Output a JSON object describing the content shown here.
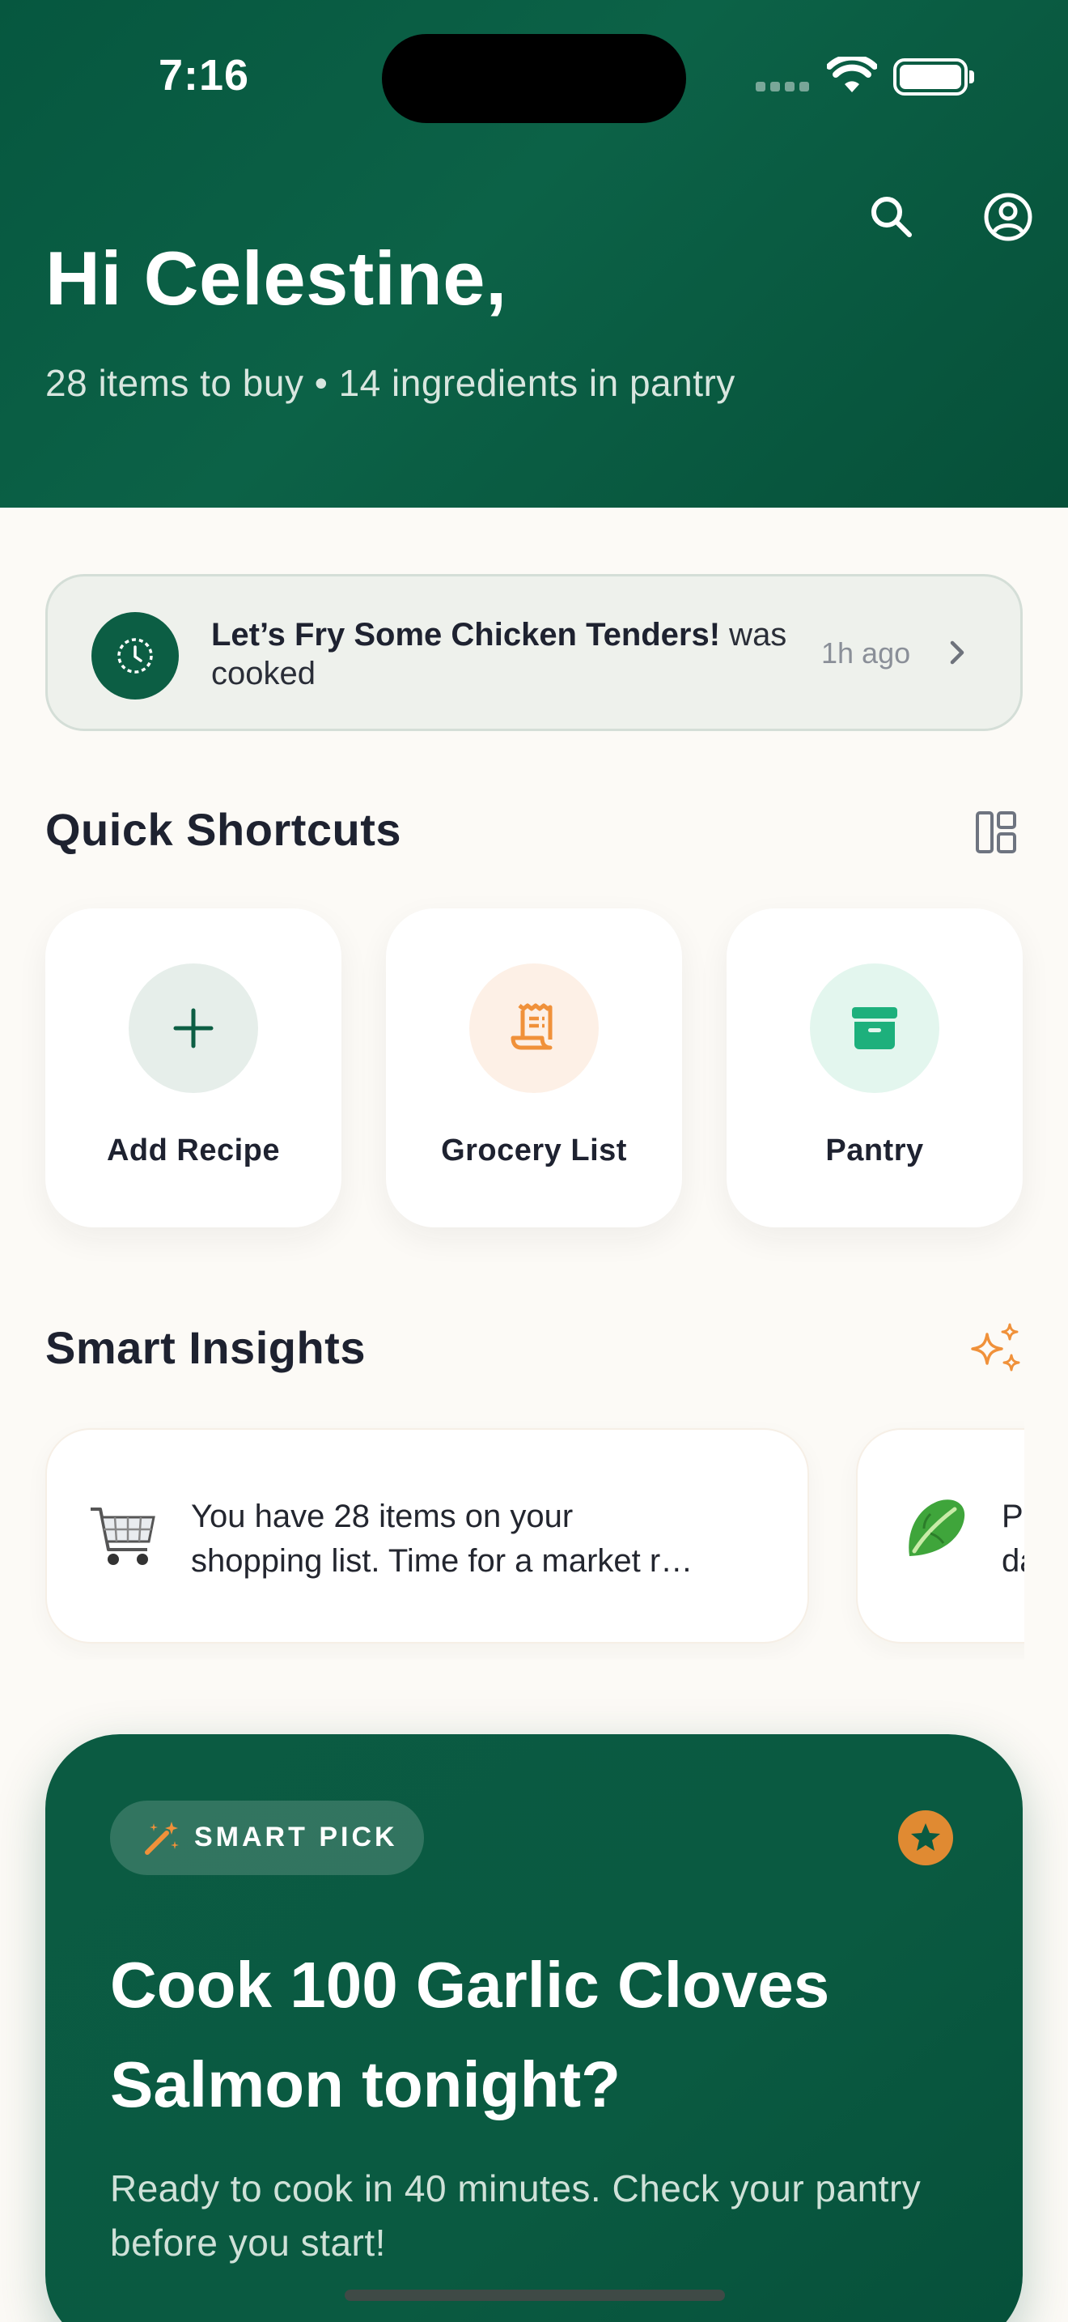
{
  "status_bar": {
    "time": "7:16"
  },
  "header": {
    "greeting": "Hi Celestine,",
    "summary": "28 items to buy • 14 ingredients in pantry",
    "icons": [
      "search-icon",
      "profile-icon"
    ]
  },
  "recent_activity": {
    "recipe_name": "Let’s Fry Some Chicken Tenders!",
    "action": " was cooked",
    "time_ago": "1h ago"
  },
  "shortcuts": {
    "title": "Quick Shortcuts",
    "items": [
      {
        "label": "Add Recipe",
        "icon": "plus-icon",
        "color": "#0C5E44"
      },
      {
        "label": "Grocery List",
        "icon": "receipt-icon",
        "color": "#F0913A"
      },
      {
        "label": "Pantry",
        "icon": "archive-box-icon",
        "color": "#1DB07C"
      }
    ]
  },
  "insights": {
    "title": "Smart Insights",
    "items": [
      {
        "emoji": "🛒",
        "line1": "You have 28 items on your",
        "line2": "shopping list. Time for a market r…"
      },
      {
        "emoji": "🥬",
        "line1": "P",
        "line2": "da"
      }
    ]
  },
  "smart_pick": {
    "badge": "SMART PICK",
    "title": "Cook 100 Garlic Cloves Salmon tonight?",
    "description": "Ready to cook in 40 minutes. Check your pantry before you start!",
    "accent": "#E08A32"
  }
}
